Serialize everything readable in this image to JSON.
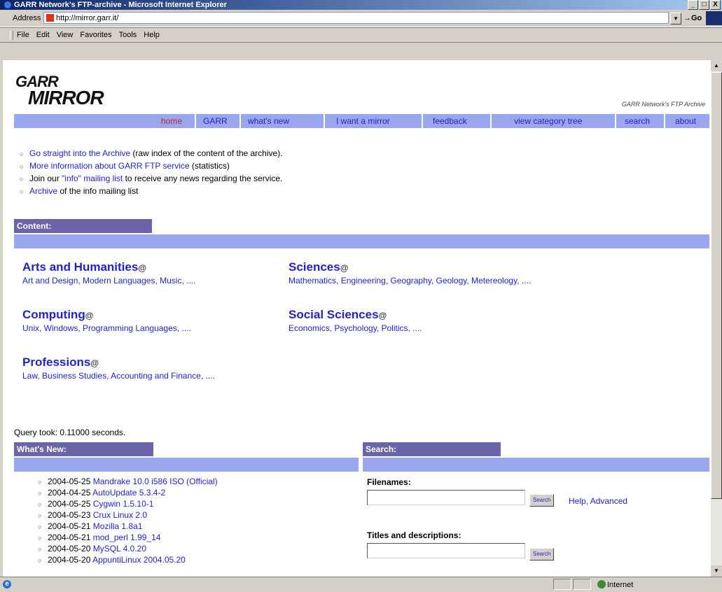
{
  "window": {
    "title": "GARR Network's FTP-archive - Microsoft Internet Explorer",
    "controls": [
      "_",
      "□",
      "X"
    ]
  },
  "addressbar": {
    "label": "Address",
    "url": "http://mirror.garr.it/",
    "go_label": "Go"
  },
  "menubar": {
    "items": [
      "File",
      "Edit",
      "View",
      "Favorites",
      "Tools",
      "Help"
    ]
  },
  "page": {
    "logo_top": "GARR",
    "logo_bottom": "MIRROR",
    "tagline": "GARR Network's FTP Archive",
    "nav": [
      "home",
      "GARR",
      "what's new",
      "I want a mirror",
      "feedback",
      "view category tree",
      "search",
      "about"
    ],
    "links": [
      {
        "link": "Go straight into the Archive",
        "text": "  (raw index of the content of the archive)."
      },
      {
        "link": "More information about GARR FTP service",
        "text": " (statistics)"
      },
      {
        "prefix": "Join our ",
        "link": "\"info\" mailing list",
        "text": " to receive any news regarding the service."
      },
      {
        "link": "Archive",
        "text": " of the info mailing list"
      }
    ],
    "content_header": "Content:",
    "categories": [
      {
        "title": "Arts and Humanities",
        "sub": "Art and Design, Modern Languages, Music, ...."
      },
      {
        "title": "Sciences",
        "sub": "Mathematics, Engineering, Geography, Geology, Metereology, ...."
      },
      {
        "title": "Computing",
        "sub": "Unix, Windows, Programming Languages, ...."
      },
      {
        "title": "Social Sciences",
        "sub": "Economics, Psychology, Politics, ...."
      },
      {
        "title": "Professions",
        "sub": "Law, Business Studies, Accounting and Finance, ...."
      }
    ],
    "at_symbol": "@",
    "query_time": "Query took: 0.11000 seconds.",
    "whatsnew_header": "What's New:",
    "news": [
      {
        "date": "2004-05-25",
        "name": "Mandrake 10.0 i586 ISO (Official)"
      },
      {
        "date": "2004-04-25",
        "name": "AutoUpdate 5.3.4-2"
      },
      {
        "date": "2004-05-25",
        "name": "Cygwin 1.5.10-1"
      },
      {
        "date": "2004-05-23",
        "name": "Crux Linux 2.0"
      },
      {
        "date": "2004-05-21",
        "name": "Mozilla 1.8a1"
      },
      {
        "date": "2004-05-21",
        "name": "mod_perl 1.99_14"
      },
      {
        "date": "2004-05-20",
        "name": "MySQL 4.0.20"
      },
      {
        "date": "2004-05-20",
        "name": "AppuntiLinux 2004.05.20"
      }
    ],
    "search_header": "Search:",
    "filenames_label": "Filenames:",
    "titles_label": "Titles and descriptions:",
    "search_button": "Search",
    "help_links": "Help, Advanced"
  },
  "status": {
    "zone": "Internet"
  }
}
